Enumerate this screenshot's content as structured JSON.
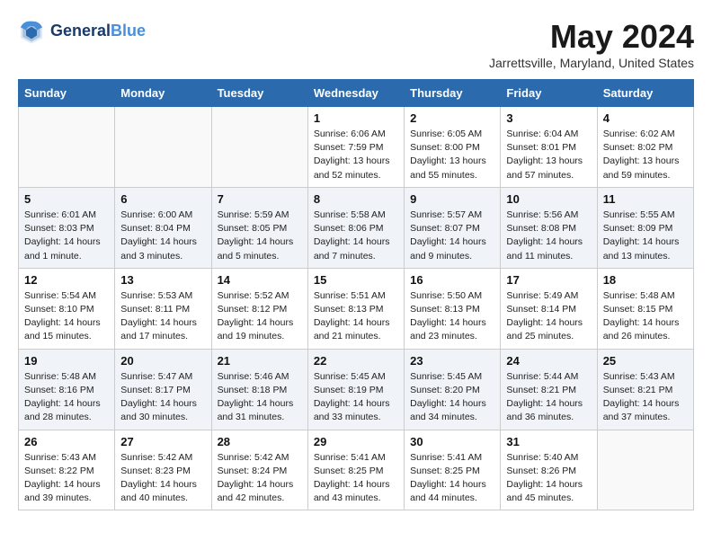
{
  "header": {
    "logo_line1": "General",
    "logo_line2": "Blue",
    "month_title": "May 2024",
    "location": "Jarrettsville, Maryland, United States"
  },
  "weekdays": [
    "Sunday",
    "Monday",
    "Tuesday",
    "Wednesday",
    "Thursday",
    "Friday",
    "Saturday"
  ],
  "weeks": [
    [
      {
        "day": "",
        "sunrise": "",
        "sunset": "",
        "daylight": ""
      },
      {
        "day": "",
        "sunrise": "",
        "sunset": "",
        "daylight": ""
      },
      {
        "day": "",
        "sunrise": "",
        "sunset": "",
        "daylight": ""
      },
      {
        "day": "1",
        "sunrise": "Sunrise: 6:06 AM",
        "sunset": "Sunset: 7:59 PM",
        "daylight": "Daylight: 13 hours and 52 minutes."
      },
      {
        "day": "2",
        "sunrise": "Sunrise: 6:05 AM",
        "sunset": "Sunset: 8:00 PM",
        "daylight": "Daylight: 13 hours and 55 minutes."
      },
      {
        "day": "3",
        "sunrise": "Sunrise: 6:04 AM",
        "sunset": "Sunset: 8:01 PM",
        "daylight": "Daylight: 13 hours and 57 minutes."
      },
      {
        "day": "4",
        "sunrise": "Sunrise: 6:02 AM",
        "sunset": "Sunset: 8:02 PM",
        "daylight": "Daylight: 13 hours and 59 minutes."
      }
    ],
    [
      {
        "day": "5",
        "sunrise": "Sunrise: 6:01 AM",
        "sunset": "Sunset: 8:03 PM",
        "daylight": "Daylight: 14 hours and 1 minute."
      },
      {
        "day": "6",
        "sunrise": "Sunrise: 6:00 AM",
        "sunset": "Sunset: 8:04 PM",
        "daylight": "Daylight: 14 hours and 3 minutes."
      },
      {
        "day": "7",
        "sunrise": "Sunrise: 5:59 AM",
        "sunset": "Sunset: 8:05 PM",
        "daylight": "Daylight: 14 hours and 5 minutes."
      },
      {
        "day": "8",
        "sunrise": "Sunrise: 5:58 AM",
        "sunset": "Sunset: 8:06 PM",
        "daylight": "Daylight: 14 hours and 7 minutes."
      },
      {
        "day": "9",
        "sunrise": "Sunrise: 5:57 AM",
        "sunset": "Sunset: 8:07 PM",
        "daylight": "Daylight: 14 hours and 9 minutes."
      },
      {
        "day": "10",
        "sunrise": "Sunrise: 5:56 AM",
        "sunset": "Sunset: 8:08 PM",
        "daylight": "Daylight: 14 hours and 11 minutes."
      },
      {
        "day": "11",
        "sunrise": "Sunrise: 5:55 AM",
        "sunset": "Sunset: 8:09 PM",
        "daylight": "Daylight: 14 hours and 13 minutes."
      }
    ],
    [
      {
        "day": "12",
        "sunrise": "Sunrise: 5:54 AM",
        "sunset": "Sunset: 8:10 PM",
        "daylight": "Daylight: 14 hours and 15 minutes."
      },
      {
        "day": "13",
        "sunrise": "Sunrise: 5:53 AM",
        "sunset": "Sunset: 8:11 PM",
        "daylight": "Daylight: 14 hours and 17 minutes."
      },
      {
        "day": "14",
        "sunrise": "Sunrise: 5:52 AM",
        "sunset": "Sunset: 8:12 PM",
        "daylight": "Daylight: 14 hours and 19 minutes."
      },
      {
        "day": "15",
        "sunrise": "Sunrise: 5:51 AM",
        "sunset": "Sunset: 8:13 PM",
        "daylight": "Daylight: 14 hours and 21 minutes."
      },
      {
        "day": "16",
        "sunrise": "Sunrise: 5:50 AM",
        "sunset": "Sunset: 8:13 PM",
        "daylight": "Daylight: 14 hours and 23 minutes."
      },
      {
        "day": "17",
        "sunrise": "Sunrise: 5:49 AM",
        "sunset": "Sunset: 8:14 PM",
        "daylight": "Daylight: 14 hours and 25 minutes."
      },
      {
        "day": "18",
        "sunrise": "Sunrise: 5:48 AM",
        "sunset": "Sunset: 8:15 PM",
        "daylight": "Daylight: 14 hours and 26 minutes."
      }
    ],
    [
      {
        "day": "19",
        "sunrise": "Sunrise: 5:48 AM",
        "sunset": "Sunset: 8:16 PM",
        "daylight": "Daylight: 14 hours and 28 minutes."
      },
      {
        "day": "20",
        "sunrise": "Sunrise: 5:47 AM",
        "sunset": "Sunset: 8:17 PM",
        "daylight": "Daylight: 14 hours and 30 minutes."
      },
      {
        "day": "21",
        "sunrise": "Sunrise: 5:46 AM",
        "sunset": "Sunset: 8:18 PM",
        "daylight": "Daylight: 14 hours and 31 minutes."
      },
      {
        "day": "22",
        "sunrise": "Sunrise: 5:45 AM",
        "sunset": "Sunset: 8:19 PM",
        "daylight": "Daylight: 14 hours and 33 minutes."
      },
      {
        "day": "23",
        "sunrise": "Sunrise: 5:45 AM",
        "sunset": "Sunset: 8:20 PM",
        "daylight": "Daylight: 14 hours and 34 minutes."
      },
      {
        "day": "24",
        "sunrise": "Sunrise: 5:44 AM",
        "sunset": "Sunset: 8:21 PM",
        "daylight": "Daylight: 14 hours and 36 minutes."
      },
      {
        "day": "25",
        "sunrise": "Sunrise: 5:43 AM",
        "sunset": "Sunset: 8:21 PM",
        "daylight": "Daylight: 14 hours and 37 minutes."
      }
    ],
    [
      {
        "day": "26",
        "sunrise": "Sunrise: 5:43 AM",
        "sunset": "Sunset: 8:22 PM",
        "daylight": "Daylight: 14 hours and 39 minutes."
      },
      {
        "day": "27",
        "sunrise": "Sunrise: 5:42 AM",
        "sunset": "Sunset: 8:23 PM",
        "daylight": "Daylight: 14 hours and 40 minutes."
      },
      {
        "day": "28",
        "sunrise": "Sunrise: 5:42 AM",
        "sunset": "Sunset: 8:24 PM",
        "daylight": "Daylight: 14 hours and 42 minutes."
      },
      {
        "day": "29",
        "sunrise": "Sunrise: 5:41 AM",
        "sunset": "Sunset: 8:25 PM",
        "daylight": "Daylight: 14 hours and 43 minutes."
      },
      {
        "day": "30",
        "sunrise": "Sunrise: 5:41 AM",
        "sunset": "Sunset: 8:25 PM",
        "daylight": "Daylight: 14 hours and 44 minutes."
      },
      {
        "day": "31",
        "sunrise": "Sunrise: 5:40 AM",
        "sunset": "Sunset: 8:26 PM",
        "daylight": "Daylight: 14 hours and 45 minutes."
      },
      {
        "day": "",
        "sunrise": "",
        "sunset": "",
        "daylight": ""
      }
    ]
  ]
}
